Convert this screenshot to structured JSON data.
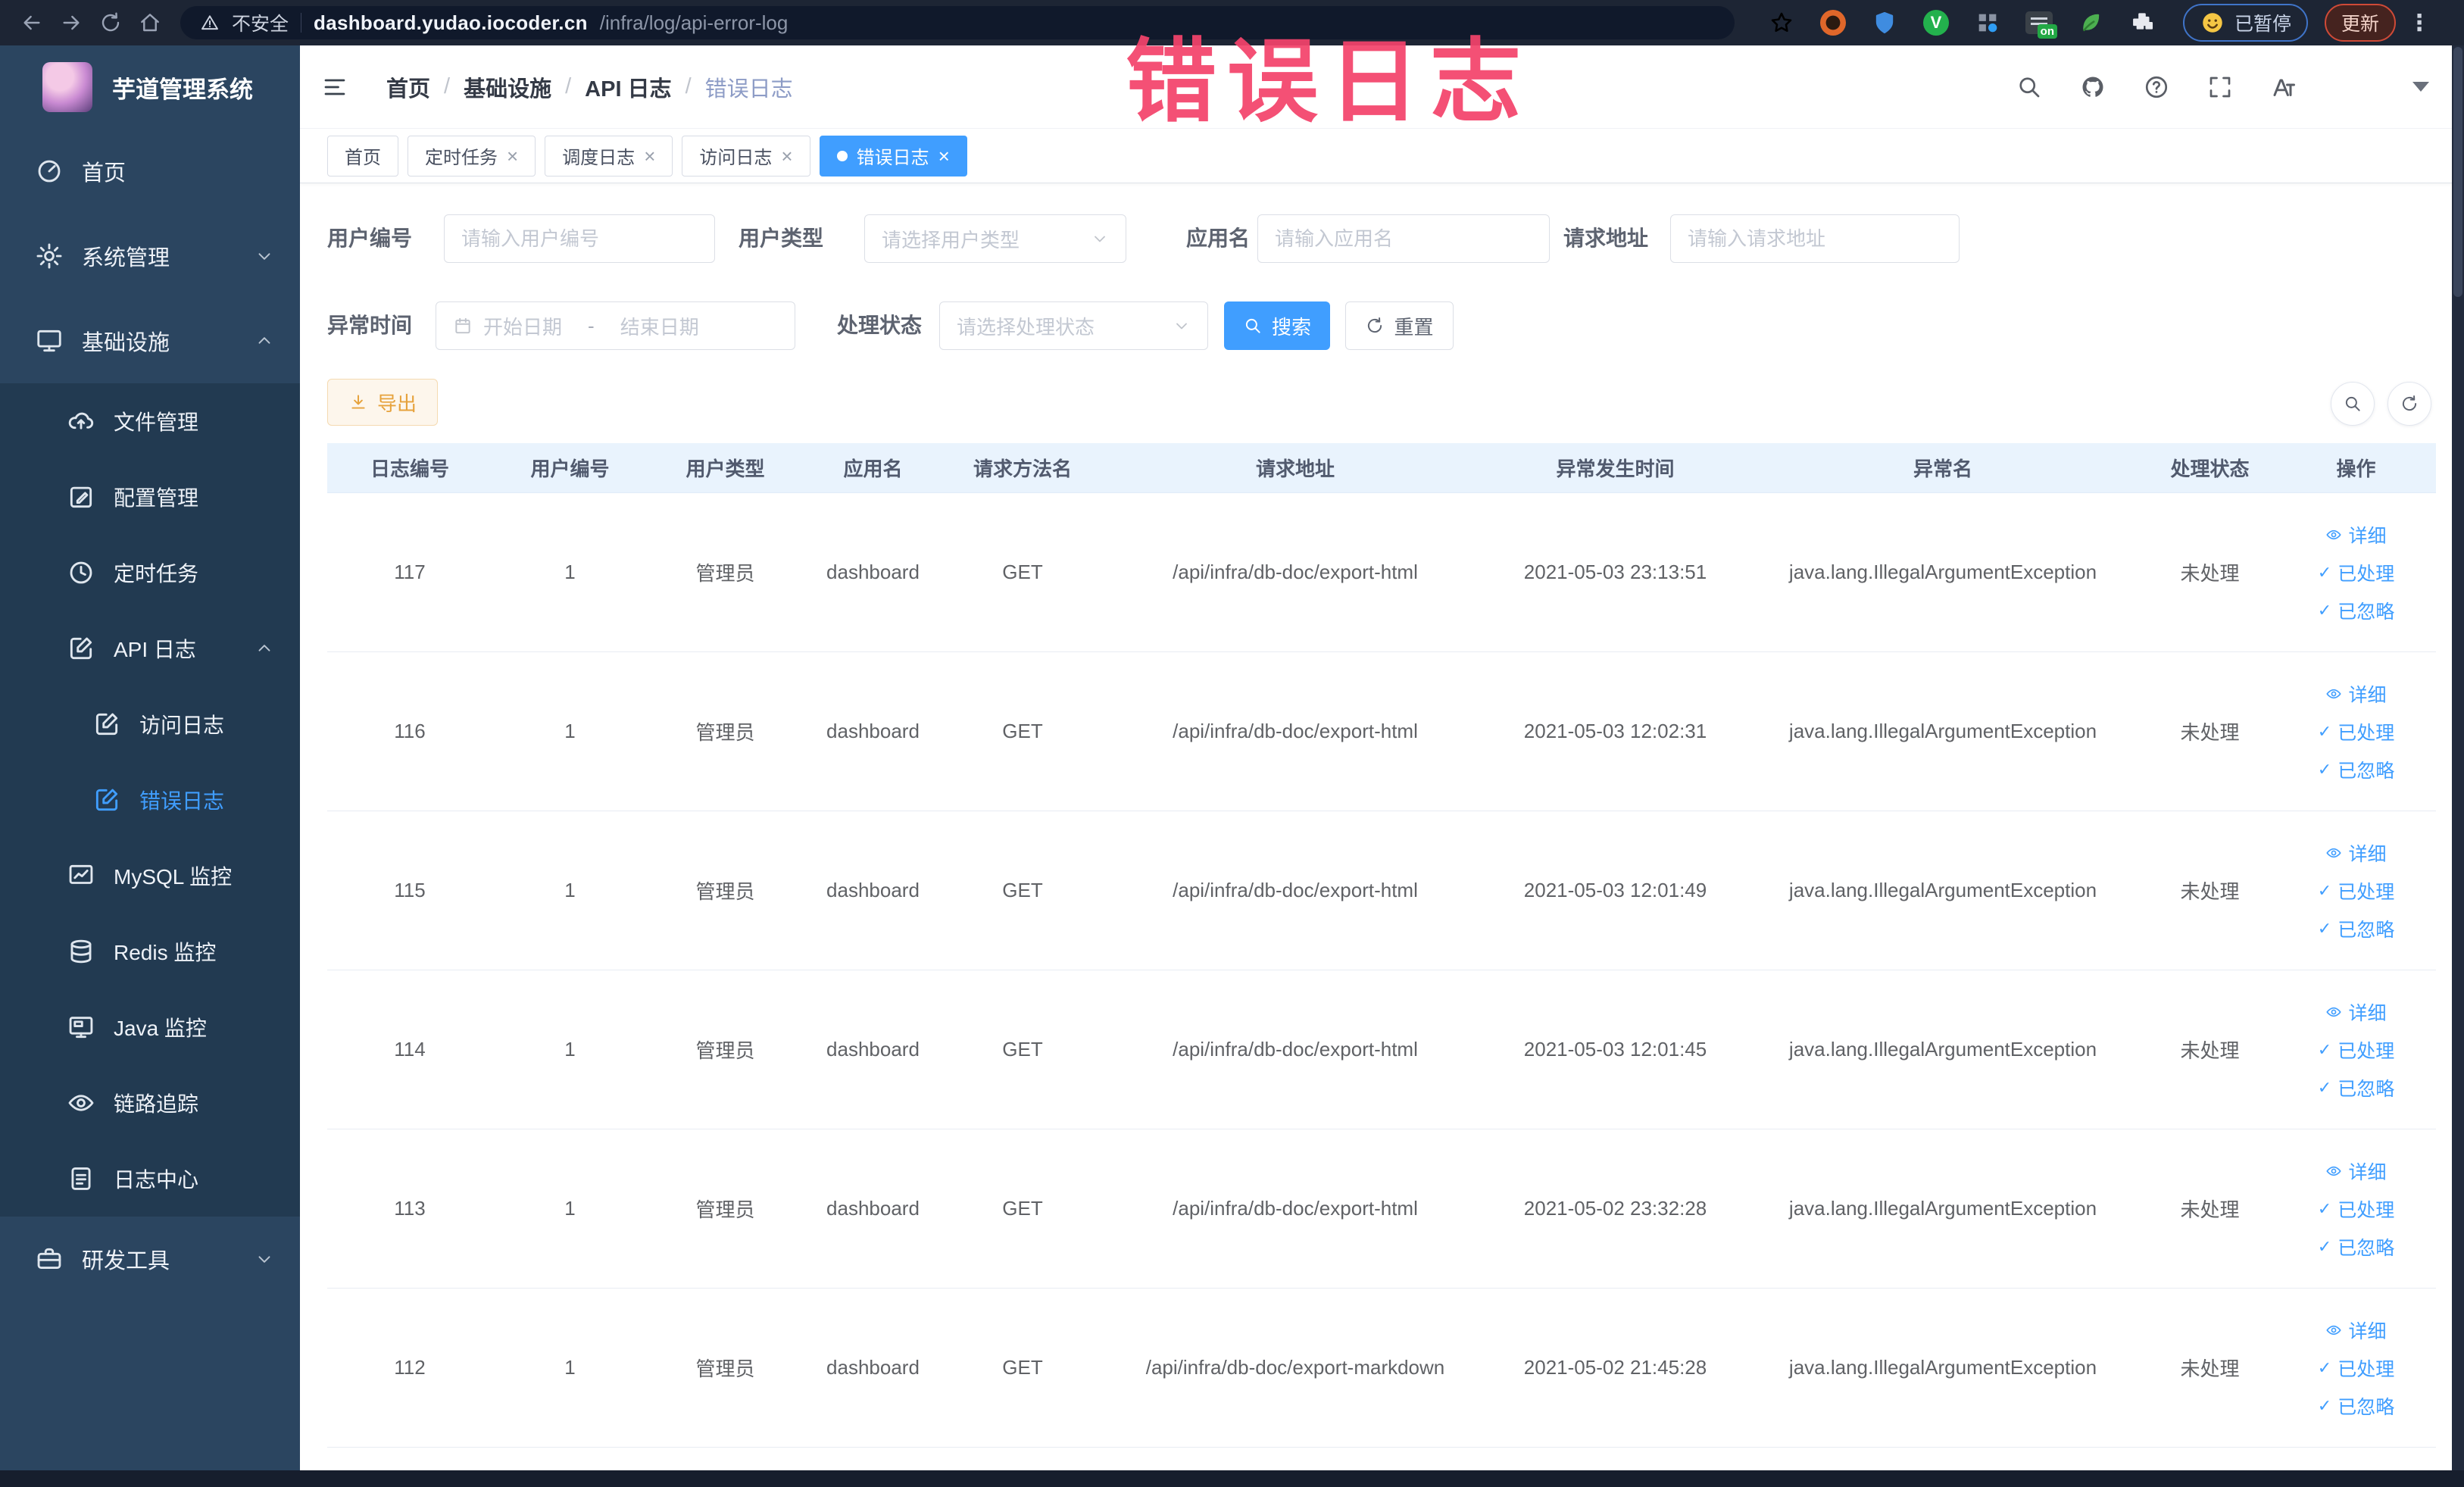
{
  "browser": {
    "security_label": "不安全",
    "url_host": "dashboard.yudao.iocoder.cn",
    "url_path": "/infra/log/api-error-log",
    "extension_on_badge": "on",
    "paused_badge": "已暂停",
    "update_button": "更新"
  },
  "annotation": {
    "text": "错误日志"
  },
  "sidebar": {
    "app_title": "芋道管理系统",
    "items": [
      {
        "id": "home",
        "label": "首页",
        "icon": "gauge",
        "level": 1
      },
      {
        "id": "system",
        "label": "系统管理",
        "icon": "gear",
        "level": 1,
        "chevron": "down"
      },
      {
        "id": "infra",
        "label": "基础设施",
        "icon": "monitor",
        "level": 1,
        "chevron": "up"
      },
      {
        "id": "file",
        "label": "文件管理",
        "icon": "cloud",
        "level": 2
      },
      {
        "id": "config",
        "label": "配置管理",
        "icon": "edit",
        "level": 2
      },
      {
        "id": "job",
        "label": "定时任务",
        "icon": "clock",
        "level": 2
      },
      {
        "id": "api-log",
        "label": "API 日志",
        "icon": "edit-square",
        "level": 2,
        "chevron": "up"
      },
      {
        "id": "access-log",
        "label": "访问日志",
        "icon": "edit-square",
        "level": 3
      },
      {
        "id": "error-log",
        "label": "错误日志",
        "icon": "edit-square",
        "level": 3,
        "active": true
      },
      {
        "id": "mysql",
        "label": "MySQL 监控",
        "icon": "chart",
        "level": 2
      },
      {
        "id": "redis",
        "label": "Redis 监控",
        "icon": "db",
        "level": 2
      },
      {
        "id": "java",
        "label": "Java 监控",
        "icon": "screen",
        "level": 2
      },
      {
        "id": "trace",
        "label": "链路追踪",
        "icon": "eye",
        "level": 2
      },
      {
        "id": "log-center",
        "label": "日志中心",
        "icon": "doc",
        "level": 2
      },
      {
        "id": "devtools",
        "label": "研发工具",
        "icon": "briefcase",
        "level": 1,
        "chevron": "down"
      }
    ]
  },
  "breadcrumb": {
    "items": [
      "首页",
      "基础设施",
      "API 日志",
      "错误日志"
    ]
  },
  "tabs": [
    {
      "label": "首页",
      "closable": false,
      "active": false
    },
    {
      "label": "定时任务",
      "closable": true,
      "active": false
    },
    {
      "label": "调度日志",
      "closable": true,
      "active": false
    },
    {
      "label": "访问日志",
      "closable": true,
      "active": false
    },
    {
      "label": "错误日志",
      "closable": true,
      "active": true
    }
  ],
  "filters": {
    "user_id": {
      "label": "用户编号",
      "placeholder": "请输入用户编号"
    },
    "user_type": {
      "label": "用户类型",
      "placeholder": "请选择用户类型"
    },
    "app_name": {
      "label": "应用名",
      "placeholder": "请输入应用名"
    },
    "request_url": {
      "label": "请求地址",
      "placeholder": "请输入请求地址"
    },
    "exception_time": {
      "label": "异常时间",
      "start_placeholder": "开始日期",
      "separator": "-",
      "end_placeholder": "结束日期"
    },
    "process_status": {
      "label": "处理状态",
      "placeholder": "请选择处理状态"
    },
    "search_label": "搜索",
    "reset_label": "重置"
  },
  "toolbar": {
    "export_label": "导出"
  },
  "table": {
    "columns": [
      "日志编号",
      "用户编号",
      "用户类型",
      "应用名",
      "请求方法名",
      "请求地址",
      "异常发生时间",
      "异常名",
      "处理状态",
      "操作"
    ],
    "action_labels": [
      "详细",
      "已处理",
      "已忽略"
    ],
    "rows": [
      {
        "id": "117",
        "user_id": "1",
        "user_type": "管理员",
        "app": "dashboard",
        "method": "GET",
        "url": "/api/infra/db-doc/export-html",
        "time": "2021-05-03 23:13:51",
        "exception": "java.lang.IllegalArgumentException",
        "status": "未处理"
      },
      {
        "id": "116",
        "user_id": "1",
        "user_type": "管理员",
        "app": "dashboard",
        "method": "GET",
        "url": "/api/infra/db-doc/export-html",
        "time": "2021-05-03 12:02:31",
        "exception": "java.lang.IllegalArgumentException",
        "status": "未处理"
      },
      {
        "id": "115",
        "user_id": "1",
        "user_type": "管理员",
        "app": "dashboard",
        "method": "GET",
        "url": "/api/infra/db-doc/export-html",
        "time": "2021-05-03 12:01:49",
        "exception": "java.lang.IllegalArgumentException",
        "status": "未处理"
      },
      {
        "id": "114",
        "user_id": "1",
        "user_type": "管理员",
        "app": "dashboard",
        "method": "GET",
        "url": "/api/infra/db-doc/export-html",
        "time": "2021-05-03 12:01:45",
        "exception": "java.lang.IllegalArgumentException",
        "status": "未处理"
      },
      {
        "id": "113",
        "user_id": "1",
        "user_type": "管理员",
        "app": "dashboard",
        "method": "GET",
        "url": "/api/infra/db-doc/export-html",
        "time": "2021-05-02 23:32:28",
        "exception": "java.lang.IllegalArgumentException",
        "status": "未处理"
      },
      {
        "id": "112",
        "user_id": "1",
        "user_type": "管理员",
        "app": "dashboard",
        "method": "GET",
        "url": "/api/infra/db-doc/export-markdown",
        "time": "2021-05-02 21:45:28",
        "exception": "java.lang.IllegalArgumentException",
        "status": "未处理"
      }
    ]
  }
}
